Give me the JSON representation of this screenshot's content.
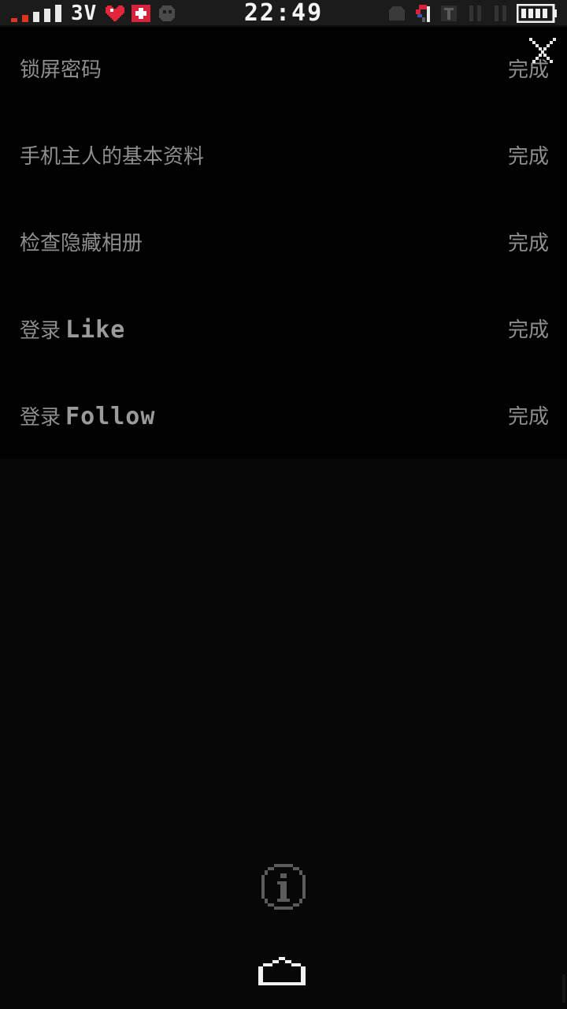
{
  "status_bar": {
    "network_type": "3V",
    "time": "22:49",
    "signal_colors": [
      "#e0341e",
      "#e0341e",
      "#e9e9e9",
      "#e9e9e9",
      "#e9e9e9"
    ],
    "icons": [
      "signal-icon",
      "heart-icon",
      "plus-icon",
      "face-icon",
      "ghost-icon",
      "flag-icon",
      "tool-icon",
      "pause-icon",
      "pause-icon",
      "battery-icon"
    ]
  },
  "settings": {
    "items": [
      {
        "label": "锁屏密码",
        "label_latin": "",
        "status": "完成"
      },
      {
        "label": "手机主人的基本资料",
        "label_latin": "",
        "status": "完成"
      },
      {
        "label": "检查隐藏相册",
        "label_latin": "",
        "status": "完成"
      },
      {
        "label": "登录",
        "label_latin": "Like",
        "status": "完成"
      },
      {
        "label": "登录",
        "label_latin": "Follow",
        "status": "完成"
      }
    ]
  },
  "colors": {
    "background": "#070707",
    "list_background": "#010101",
    "text": "#8e8e8e",
    "status_bar": "#1b1b1b",
    "accent_red": "#d6223a"
  },
  "bottom": {
    "icons": [
      "info-icon",
      "home-icon"
    ]
  }
}
